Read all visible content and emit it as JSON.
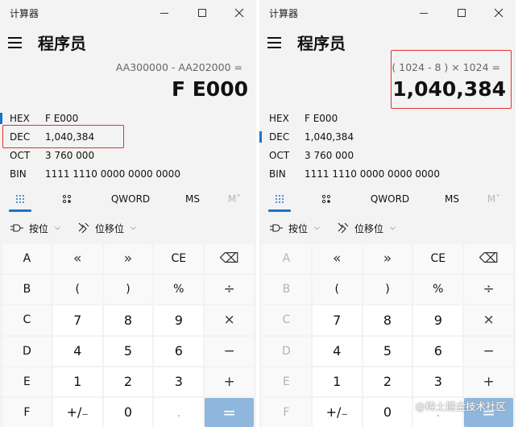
{
  "app": {
    "title": "计算器",
    "mode": "程序员"
  },
  "colors": {
    "accent": "#1a73c8",
    "highlight_border": "#e0332b",
    "equals_button": "#8fb6dc",
    "window_bg": "#f3f3f3"
  },
  "left": {
    "expression": "AA300000 - AA202000 =",
    "result": "F E000",
    "radix": [
      {
        "name": "HEX",
        "value": "F E000",
        "selected": true
      },
      {
        "name": "DEC",
        "value": "1,040,384",
        "selected": false
      },
      {
        "name": "OCT",
        "value": "3 760 000",
        "selected": false
      },
      {
        "name": "BIN",
        "value": "1111 1110 0000 0000 0000",
        "selected": false
      }
    ],
    "keys_disabled": []
  },
  "right": {
    "expression": "( 1024 - 8 ) × 1024 =",
    "result": "1,040,384",
    "radix": [
      {
        "name": "HEX",
        "value": "F E000",
        "selected": false
      },
      {
        "name": "DEC",
        "value": "1,040,384",
        "selected": true
      },
      {
        "name": "OCT",
        "value": "3 760 000",
        "selected": false
      },
      {
        "name": "BIN",
        "value": "1111 1110 0000 0000 0000",
        "selected": false
      }
    ]
  },
  "tabs": {
    "keypad_icon": "keypad-grid-icon",
    "bit_icon": "bit-toggle-icon",
    "word": "QWORD",
    "ms": "MS",
    "mstore": "M˅"
  },
  "tools": {
    "bitwise": "按位",
    "bitwise_icon": "logic-gate-icon",
    "bitshift": "位移位",
    "bitshift_icon": "bitshift-icon"
  },
  "keypad": [
    [
      "A",
      "«",
      "»",
      "CE",
      "⌫"
    ],
    [
      "B",
      "(",
      ")",
      "%",
      "÷"
    ],
    [
      "C",
      "7",
      "8",
      "9",
      "×"
    ],
    [
      "D",
      "4",
      "5",
      "6",
      "−"
    ],
    [
      "E",
      "1",
      "2",
      "3",
      "+"
    ],
    [
      "F",
      "+/₋",
      "0",
      ".",
      "="
    ]
  ],
  "watermark": "@稀土掘金技术社区"
}
